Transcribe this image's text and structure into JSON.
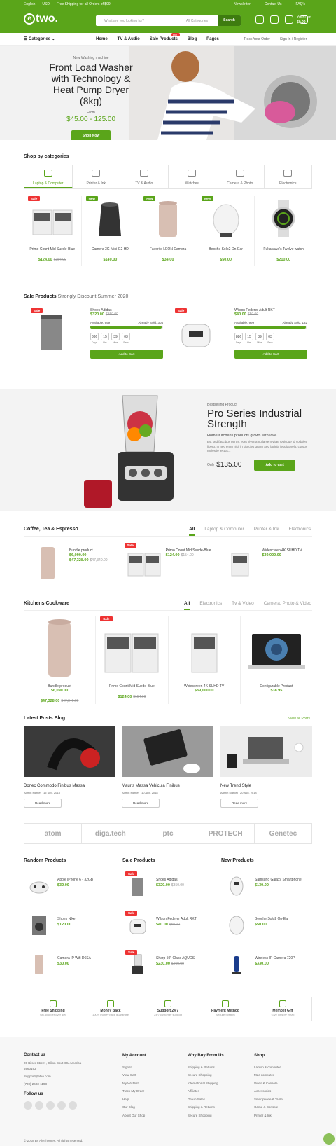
{
  "topbar": {
    "lang": "English",
    "currency": "USD",
    "shipping": "Free Shipping for all Orders of $99",
    "newsletter": "Newsletter",
    "contact": "Contact Us",
    "faq": "FAQ's"
  },
  "logo": {
    "mark": "e",
    "text": "two."
  },
  "search": {
    "placeholder": "What are you looking for?",
    "category": "All Categories",
    "button": "Search"
  },
  "cart": {
    "label": "Your Cart",
    "total": "$0.00",
    "count": "0"
  },
  "nav": {
    "categories": "Categories",
    "items": [
      "Home",
      "TV & Audio",
      "Sale Products",
      "Blog",
      "Pages"
    ],
    "hot": "HOT",
    "track": "Track Your Order",
    "signin": "Sign In / Register"
  },
  "hero": {
    "subtitle": "New Washing machine",
    "title": "Front Load Washer with Technology & Heat Pump Dryer (8kg)",
    "from": "From",
    "price": "$45.00 - 125.00",
    "button": "Shop Now"
  },
  "shop_by": {
    "title": "Shop by categories",
    "tabs": [
      "Laptop & Computer",
      "Printer & Ink",
      "TV & Audio",
      "Watches",
      "Camera & Photo",
      "Electronics"
    ]
  },
  "cat_products": [
    {
      "badge": "Sale",
      "name": "Primo Count Mid Suede-Blue",
      "price": "$124.00",
      "old": "$154.00"
    },
    {
      "badge": "New",
      "name": "Camera 3G Mini G2 HD",
      "price": "$140.00",
      "old": ""
    },
    {
      "badge": "New",
      "name": "Favorite LEON Camera",
      "price": "$34.00",
      "old": ""
    },
    {
      "badge": "New",
      "name": "Beoche Solo2 On-Ear",
      "price": "$50.00",
      "old": ""
    },
    {
      "badge": "",
      "name": "Fukasawa's Twelve watch",
      "price": "$210.00",
      "old": ""
    }
  ],
  "sale_products": {
    "title": "Sale Products",
    "subtitle": "Strongly Discount Summer 2020",
    "items": [
      {
        "badge": "Sale",
        "name": "Shoes Adidas",
        "price": "$320.00",
        "old": "$350.00",
        "available": "Available: 999",
        "sold": "Already Sold: 304",
        "progress": 0.98,
        "days": "886",
        "hrs": "15",
        "mins": "39",
        "secs": "03",
        "btn": "Add to Cart"
      },
      {
        "badge": "Sale",
        "name": "Wilson Federer Adult RKT",
        "price": "$40.00",
        "old": "$50.00",
        "available": "Available: 999",
        "sold": "Already Sold: 132",
        "progress": 0.98,
        "days": "886",
        "hrs": "15",
        "mins": "39",
        "secs": "03",
        "btn": "Add to Cart"
      }
    ],
    "labels": {
      "days": "Days",
      "hrs": "Hrs",
      "mins": "Mins",
      "secs": "Secs"
    }
  },
  "promo": {
    "subtitle": "Bestselling Product",
    "title": "Pro Series Industrial Strength",
    "tag": "Home Kitchens products grown with love",
    "desc": "Est sed faucibus purus, eget viverra nulla sem vitae Quisque id sodales libero. In nec enim nisi, in ultricies quam Sed lacinia feugiat velit, cursus molestie lectus...",
    "only": "Only",
    "price": "$135.00",
    "button": "Add to cart"
  },
  "coffee": {
    "title": "Coffee, Tea & Espresso",
    "tabs": [
      "All",
      "Laptop & Computer",
      "Printer & Ink",
      "Electronics"
    ],
    "items": [
      {
        "badge": "",
        "name": "Bundle product",
        "p1": "$6,090.00",
        "p2": "$47,328.00",
        "old": "$47,340.00"
      },
      {
        "badge": "Sale",
        "name": "Primo Count Mid Suede-Blue",
        "p1": "$124.00",
        "p2": "",
        "old": "$154.00"
      },
      {
        "badge": "",
        "name": "Widescreen 4K SUHD TV",
        "p1": "$39,000.00",
        "p2": "",
        "old": ""
      }
    ]
  },
  "kitchen": {
    "title": "Kitchens Cookware",
    "tabs": [
      "All",
      "Electronics",
      "Tv & Video",
      "Camera, Photo & Video"
    ],
    "items": [
      {
        "badge": "",
        "name": "Bundle product",
        "p1": "$6,090.00",
        "p2": "$47,328.00",
        "old": "$47,340.00"
      },
      {
        "badge": "Sale",
        "name": "Primo Count Mid Suede-Blue",
        "p1": "$124.00",
        "p2": "",
        "old": "$154.00"
      },
      {
        "badge": "",
        "name": "Widescreen 4K SUHD TV",
        "p1": "$39,000.00",
        "p2": "",
        "old": ""
      },
      {
        "badge": "",
        "name": "Configurable Product",
        "p1": "$38.95",
        "p2": "",
        "old": ""
      }
    ]
  },
  "blog": {
    "title": "Latest Posts Blog",
    "view_all": "View all Posts",
    "posts": [
      {
        "title": "Donec Commodo Finibus Massa",
        "author": "Admin Market",
        "date": "15 Sep, 2018",
        "btn": "Read more"
      },
      {
        "title": "Mauris Massa Vehicula Finibus",
        "author": "Admin Market",
        "date": "10 Aug, 2018",
        "btn": "Read more"
      },
      {
        "title": "New Trend Style",
        "author": "Admin Market",
        "date": "20 Aug, 2018",
        "btn": "Read more"
      }
    ]
  },
  "brands": [
    "atom",
    "diga.tech",
    "ptc",
    "PROTECH",
    "Genetec"
  ],
  "random": {
    "title": "Random Products",
    "items": [
      {
        "name": "Apple iPhone 6 - 32GB",
        "price": "$30.00",
        "old": ""
      },
      {
        "name": "Shoes Nike",
        "price": "$120.00",
        "old": ""
      },
      {
        "name": "Camera IP Wifi D6SA",
        "price": "$30.00",
        "old": ""
      }
    ]
  },
  "sale_list": {
    "title": "Sale Products",
    "items": [
      {
        "name": "Shoes Adidas",
        "price": "$320.00",
        "old": "$350.00"
      },
      {
        "name": "Wilson Federer Adult RKT",
        "price": "$40.00",
        "old": "$50.00"
      },
      {
        "name": "Sharp 50\" Class AQUOS",
        "price": "$230.00",
        "old": "$400.00"
      }
    ]
  },
  "new_list": {
    "title": "New Products",
    "items": [
      {
        "name": "Samsung Galaxy Smartphone",
        "price": "$130.00",
        "old": ""
      },
      {
        "name": "Beoche Solo2 On-Ear",
        "price": "$50.00",
        "old": ""
      },
      {
        "name": "Wireless IP Camera 720P",
        "price": "$330.00",
        "old": ""
      }
    ]
  },
  "features": [
    {
      "t": "Free Shipping",
      "s": "On all order over $99"
    },
    {
      "t": "Money Back",
      "s": "100% money back guarantee"
    },
    {
      "t": "Support 24/7",
      "s": "24/7 customer support"
    },
    {
      "t": "Payment Method",
      "s": "Secure System"
    },
    {
      "t": "Member Gift",
      "s": "Give gifts by email"
    }
  ],
  "footer": {
    "contact": {
      "h": "Contact us",
      "addr": "20 Bilser Street , Silion Cout IOL America 5960193",
      "email": "Support@etko.com",
      "phone": "(700) 2603-1198",
      "follow": "Follow us"
    },
    "account": {
      "h": "My Account",
      "links": [
        "Sign In",
        "View Cart",
        "My Wishlist",
        "Track My Order",
        "Help",
        "Our Blog",
        "About Our Shop"
      ]
    },
    "why": {
      "h": "Why Buy From Us",
      "links": [
        "Shipping & Returns",
        "Secure Shopping",
        "International Shipping",
        "Affiliates",
        "Group Sales",
        "Shipping & Returns",
        "Secure Shopping"
      ]
    },
    "shop": {
      "h": "Shop",
      "links": [
        "Laptop & computer",
        "Mac computer",
        "Video & Console",
        "Accessories",
        "Smartphone & Tablet",
        "Game & Console",
        "Printer & Ink"
      ]
    },
    "copyright": "© 2018 By AloThemes. All rights reserved."
  }
}
